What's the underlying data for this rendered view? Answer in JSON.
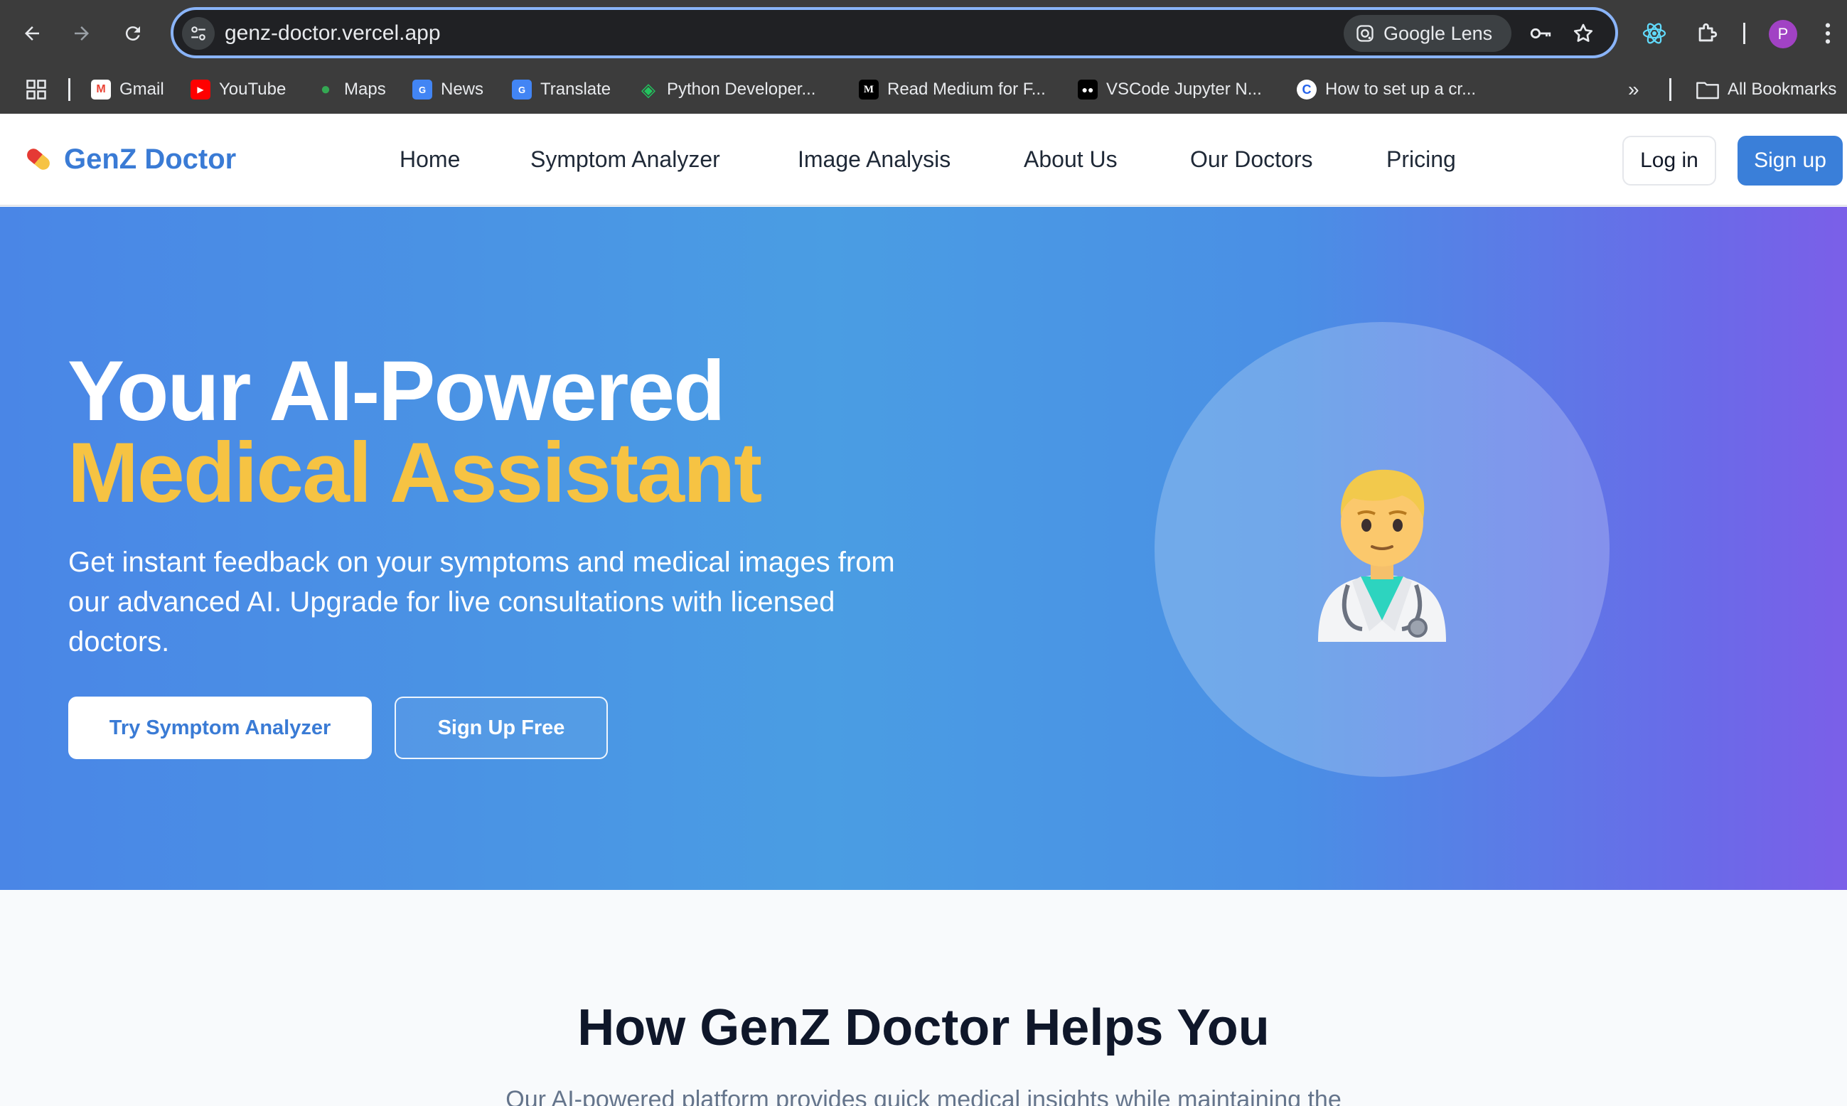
{
  "browser": {
    "url": "genz-doctor.vercel.app",
    "lens_label": "Google Lens",
    "profile_initial": "P",
    "bookmarks": [
      {
        "label": "Gmail",
        "icon": "gmail-icon"
      },
      {
        "label": "YouTube",
        "icon": "youtube-icon"
      },
      {
        "label": "Maps",
        "icon": "maps-icon"
      },
      {
        "label": "News",
        "icon": "news-icon"
      },
      {
        "label": "Translate",
        "icon": "translate-icon"
      },
      {
        "label": "Python Developer...",
        "icon": "python-icon"
      },
      {
        "label": "Read Medium for F...",
        "icon": "medium-icon"
      },
      {
        "label": "VSCode Jupyter N...",
        "icon": "medium-dots-icon"
      },
      {
        "label": "How to set up a cr...",
        "icon": "c-icon"
      }
    ],
    "all_bookmarks": "All Bookmarks",
    "colors": {
      "chrome": "#3c3c3c",
      "omnibox": "#202124",
      "focus": "#8ab4f8"
    }
  },
  "site": {
    "brand": "GenZ Doctor",
    "nav": [
      "Home",
      "Symptom Analyzer",
      "Image Analysis",
      "About Us",
      "Our Doctors",
      "Pricing"
    ],
    "login": "Log in",
    "signup": "Sign up",
    "colors": {
      "brand": "#3a7bd5",
      "accent": "#f6c343"
    }
  },
  "hero": {
    "title_line1": "Your AI-Powered",
    "title_line2": "Medical Assistant",
    "description": "Get instant feedback on your symptoms and medical images from our advanced AI. Upgrade for live consultations with licensed doctors.",
    "cta_primary": "Try Symptom Analyzer",
    "cta_secondary": "Sign Up Free",
    "illustration": "doctor-icon"
  },
  "features": {
    "title": "How GenZ Doctor Helps You",
    "subtitle": "Our AI-powered platform provides quick medical insights while maintaining the"
  }
}
